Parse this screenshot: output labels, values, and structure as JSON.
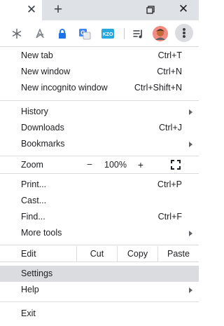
{
  "tabstrip": {
    "close_tab_glyph": "✕",
    "new_tab_glyph": "+",
    "close_window_glyph": "✕"
  },
  "toolbar": {
    "extension_icons": [
      "snowflake-icon",
      "acrobat-icon",
      "lock-icon",
      "translate-icon",
      "kzo-icon"
    ],
    "kzo_label": "KZO",
    "translate_label": "G",
    "reading_list_icon": "reading-list-icon",
    "profile_icon": "avatar",
    "menu_icon": "three-dots-icon"
  },
  "menu": {
    "new_tab": {
      "label": "New tab",
      "shortcut": "Ctrl+T"
    },
    "new_window": {
      "label": "New window",
      "shortcut": "Ctrl+N"
    },
    "new_incognito": {
      "label": "New incognito window",
      "shortcut": "Ctrl+Shift+N"
    },
    "history": {
      "label": "History"
    },
    "downloads": {
      "label": "Downloads",
      "shortcut": "Ctrl+J"
    },
    "bookmarks": {
      "label": "Bookmarks"
    },
    "zoom": {
      "label": "Zoom",
      "minus": "–",
      "value": "100%",
      "plus": "+"
    },
    "print": {
      "label": "Print...",
      "shortcut": "Ctrl+P"
    },
    "cast": {
      "label": "Cast..."
    },
    "find": {
      "label": "Find...",
      "shortcut": "Ctrl+F"
    },
    "more_tools": {
      "label": "More tools"
    },
    "edit": {
      "label": "Edit",
      "cut": "Cut",
      "copy": "Copy",
      "paste": "Paste"
    },
    "settings": {
      "label": "Settings"
    },
    "help": {
      "label": "Help"
    },
    "exit": {
      "label": "Exit"
    }
  },
  "colors": {
    "tabstrip": "#dee1e6",
    "highlight": "#dadce0",
    "divider": "#dadce0",
    "text": "#202124"
  }
}
